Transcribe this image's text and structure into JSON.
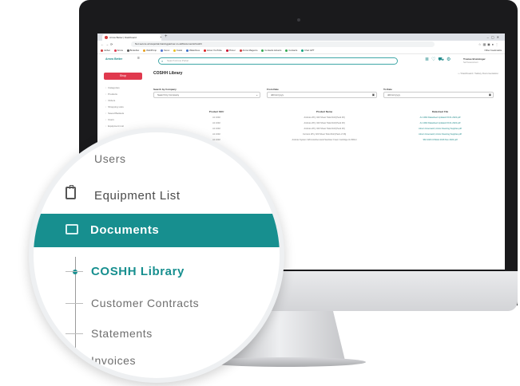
{
  "browser": {
    "tab_title": "Arrow Better | Dashboard",
    "url": "Not secure   arrowportal.trainingpartner.co.uk/Documents/Coshh",
    "bookmarks": [
      "Jarbet",
      "Arrow",
      "Brokeflex",
      "WebPrimp",
      "Xerox",
      "Kodel",
      "Waterlines",
      "Arrow YouTube",
      "Pinner",
      "Arrow Magento",
      "Contacts Adverts",
      "Contacts",
      "Chat GPT"
    ],
    "other_bookmarks": "Other bookmarks"
  },
  "app": {
    "logo": "Arrow Better",
    "shop_label": "Shop",
    "sidebar": [
      "Categories",
      "Products",
      "Orders",
      "Shopping Lists",
      "Saved Baskets",
      "Users",
      "Equipment List"
    ],
    "search_placeholder": "Search Arrow Portal",
    "user_name": "Trustee Brunninger",
    "user_sub": "Self Assessment",
    "page_title": "COSHH Library",
    "breadcrumb": "⌂ / Dashboard / Safety Documentation",
    "filters": {
      "company_label": "Search by Company",
      "company_value": "Search by Company",
      "from_label": "From Date",
      "from_value": "dd/mm/yyyy",
      "to_label": "To Date",
      "to_value": "dd/mm/yyyy"
    },
    "table": {
      "headers": [
        "Product SKU",
        "Product Name",
        "Datasheet File"
      ],
      "rows": [
        [
          "A1 1002",
          "Arobots 2Pry 320 Sheet Toilet Roll [Pack 36]",
          "A1 1002 Datasheet Updated 15.01.2022.pdf"
        ],
        [
          "A1 1002",
          "Arobots 2Pry 320 Sheet Toilet Roll [Pack 36]",
          "A1 1002 Datasheet Updated 15.01.2022.pdf"
        ],
        [
          "A1 1002",
          "Arobots 2Pry 320 Sheet Toilet Roll [Pack 36]",
          "Airson Greenwell, Arrow Cleaning Supplies.pdf"
        ],
        [
          "A1 1002",
          "Curriero 2Pry 320 Sheet Toilet Roll [Pack of 36]",
          "Airson Greenwell, Arrow Cleaning Supplies.pdf"
        ],
        [
          "A1 1002",
          "Arobots System 320 Autoline Hand Sanitiser Foam Cartridge 3x 800ml",
          "SM 1029 COSHH 2016 Nov 2022.pdf"
        ]
      ]
    }
  },
  "magnifier": {
    "users": "Users",
    "equipment": "Equipment List",
    "documents": "Documents",
    "coshh": "COSHH Library",
    "contracts": "Customer Contracts",
    "statements": "Statements",
    "invoices": "Invoices"
  },
  "colors": {
    "teal": "#178f8f",
    "shop_red": "#e0394e"
  },
  "icons": {
    "equipment": "clipboard-icon",
    "documents": "folder-icon"
  }
}
